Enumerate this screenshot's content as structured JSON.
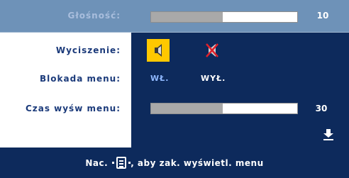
{
  "volume": {
    "label": "Głośność:",
    "value": "10",
    "level": 0.49
  },
  "mute": {
    "label": "Wyciszenie:",
    "options": [
      "speaker-icon",
      "speaker-muted-icon"
    ],
    "selected": "speaker-icon"
  },
  "menu_lock": {
    "label": "Blokada menu:",
    "on_label": "WŁ.",
    "off_label": "WYŁ.",
    "selected": "WŁ."
  },
  "menu_timeout": {
    "label": "Czas wyśw menu:",
    "value": "30",
    "level": 0.49
  },
  "scroll_down_icon": "arrow-down-icon",
  "footer": {
    "prefix": "Nac.",
    "key_icon": "menu-key-icon",
    "suffix": ", aby zak. wyświetl. menu"
  },
  "colors": {
    "header": "#6e92b8",
    "panel": "#0d2a5c",
    "accent": "#ffc800",
    "label_text": "#1b3a7a",
    "selected_option": "#8fb8ff"
  }
}
